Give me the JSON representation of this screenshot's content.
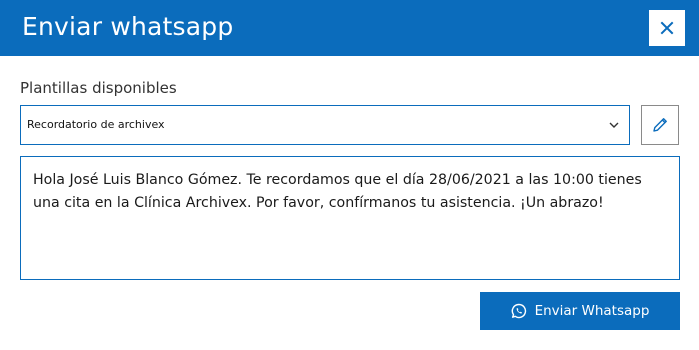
{
  "dialog": {
    "title": "Enviar whatsapp",
    "close_icon": "close-icon"
  },
  "templates": {
    "label": "Plantillas disponibles",
    "selected": "Recordatorio de archivex",
    "chevron_icon": "chevron-down-icon",
    "edit_icon": "pencil-icon"
  },
  "message": {
    "text": "Hola José Luis Blanco Gómez. Te recordamos que el día 28/06/2021 a las 10:00 tienes una cita en la Clínica Archivex. Por favor, confírmanos tu asistencia. ¡Un abrazo!"
  },
  "actions": {
    "send_label": "Enviar Whatsapp",
    "send_icon": "whatsapp-icon"
  },
  "colors": {
    "accent": "#0b6cbc",
    "edit_border": "#8a8a8a"
  }
}
